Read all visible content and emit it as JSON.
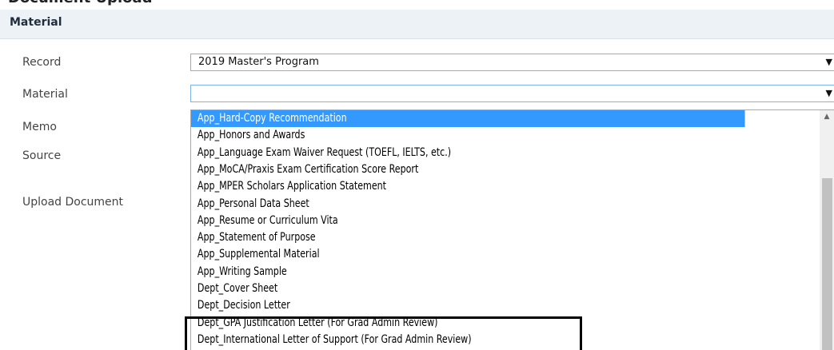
{
  "top_heading": "Document Upload",
  "section": {
    "title": "Material"
  },
  "fields": {
    "record": {
      "label": "Record",
      "value": "2019 Master's Program"
    },
    "material": {
      "label": "Material",
      "value": ""
    },
    "memo": {
      "label": "Memo"
    },
    "source": {
      "label": "Source"
    },
    "upload": {
      "label": "Upload Document"
    }
  },
  "dropdown": {
    "selected_index": 0,
    "options": [
      "App_Hard-Copy Recommendation",
      "App_Honors and Awards",
      "App_Language Exam Waiver Request (TOEFL, IELTS, etc.)",
      "App_MoCA/Praxis Exam Certification Score Report",
      "App_MPER Scholars Application Statement",
      "App_Personal Data Sheet",
      "App_Resume or Curriculum Vita",
      "App_Statement of Purpose",
      "App_Supplemental Material",
      "App_Writing Sample",
      "Dept_Cover Sheet",
      "Dept_Decision Letter",
      "Dept_GPA Justification Letter (For Grad Admin Review)",
      "Dept_International Letter of Support (For Grad Admin Review)"
    ]
  },
  "icons": {
    "select_arrow": "caret-down-icon",
    "scroll_up": "scroll-up-arrow-icon"
  },
  "colors": {
    "selected_option": "#3399ff",
    "header_bg": "#edf2f7",
    "highlight_box": "#000000"
  }
}
